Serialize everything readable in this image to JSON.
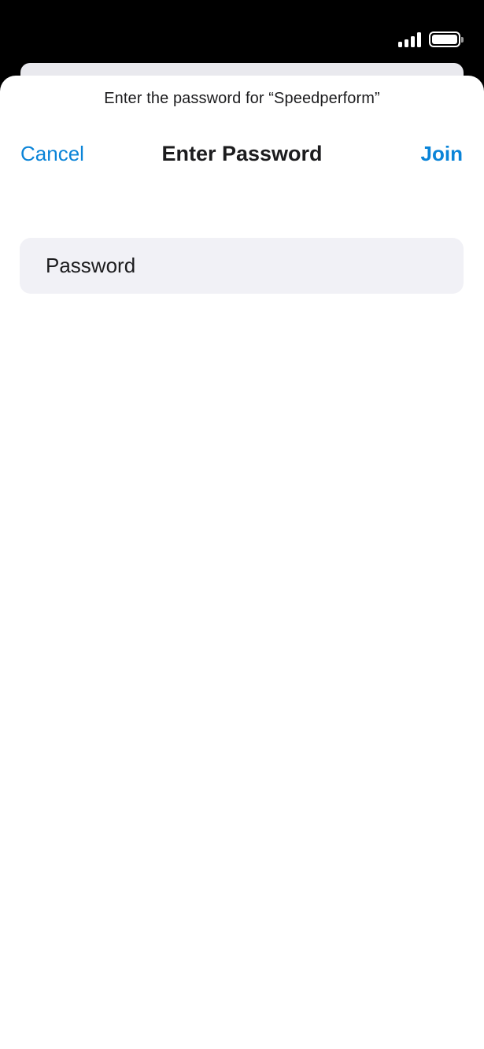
{
  "status_bar": {
    "signal_icon": "cellular-signal-icon",
    "battery_icon": "battery-icon",
    "battery_level": 1.0
  },
  "sheet": {
    "prompt": "Enter the password for “Speedperform”",
    "nav": {
      "cancel_label": "Cancel",
      "title": "Enter Password",
      "join_label": "Join"
    },
    "password_field": {
      "placeholder": "Password",
      "value": ""
    }
  },
  "colors": {
    "accent": "#0a84d8",
    "text": "#1c1c1e",
    "field_background": "#f1f1f6",
    "status_bar_background": "#000000"
  }
}
